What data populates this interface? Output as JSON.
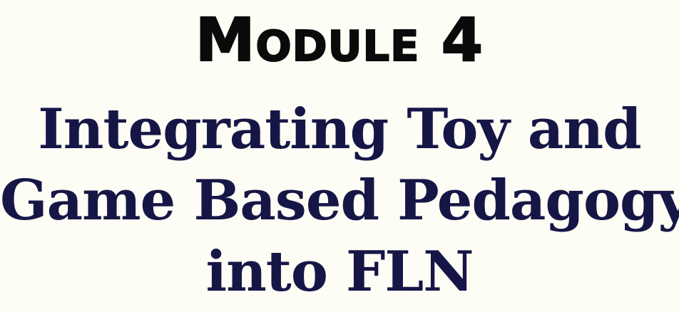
{
  "heading": {
    "module_label": "Module 4"
  },
  "title": {
    "lines": [
      "Integrating Toy and",
      "Game Based Pedagogy",
      "into FLN"
    ]
  },
  "colors": {
    "background": "#fdfcf5",
    "heading_text": "#0a0a0a",
    "title_text": "#161646"
  }
}
